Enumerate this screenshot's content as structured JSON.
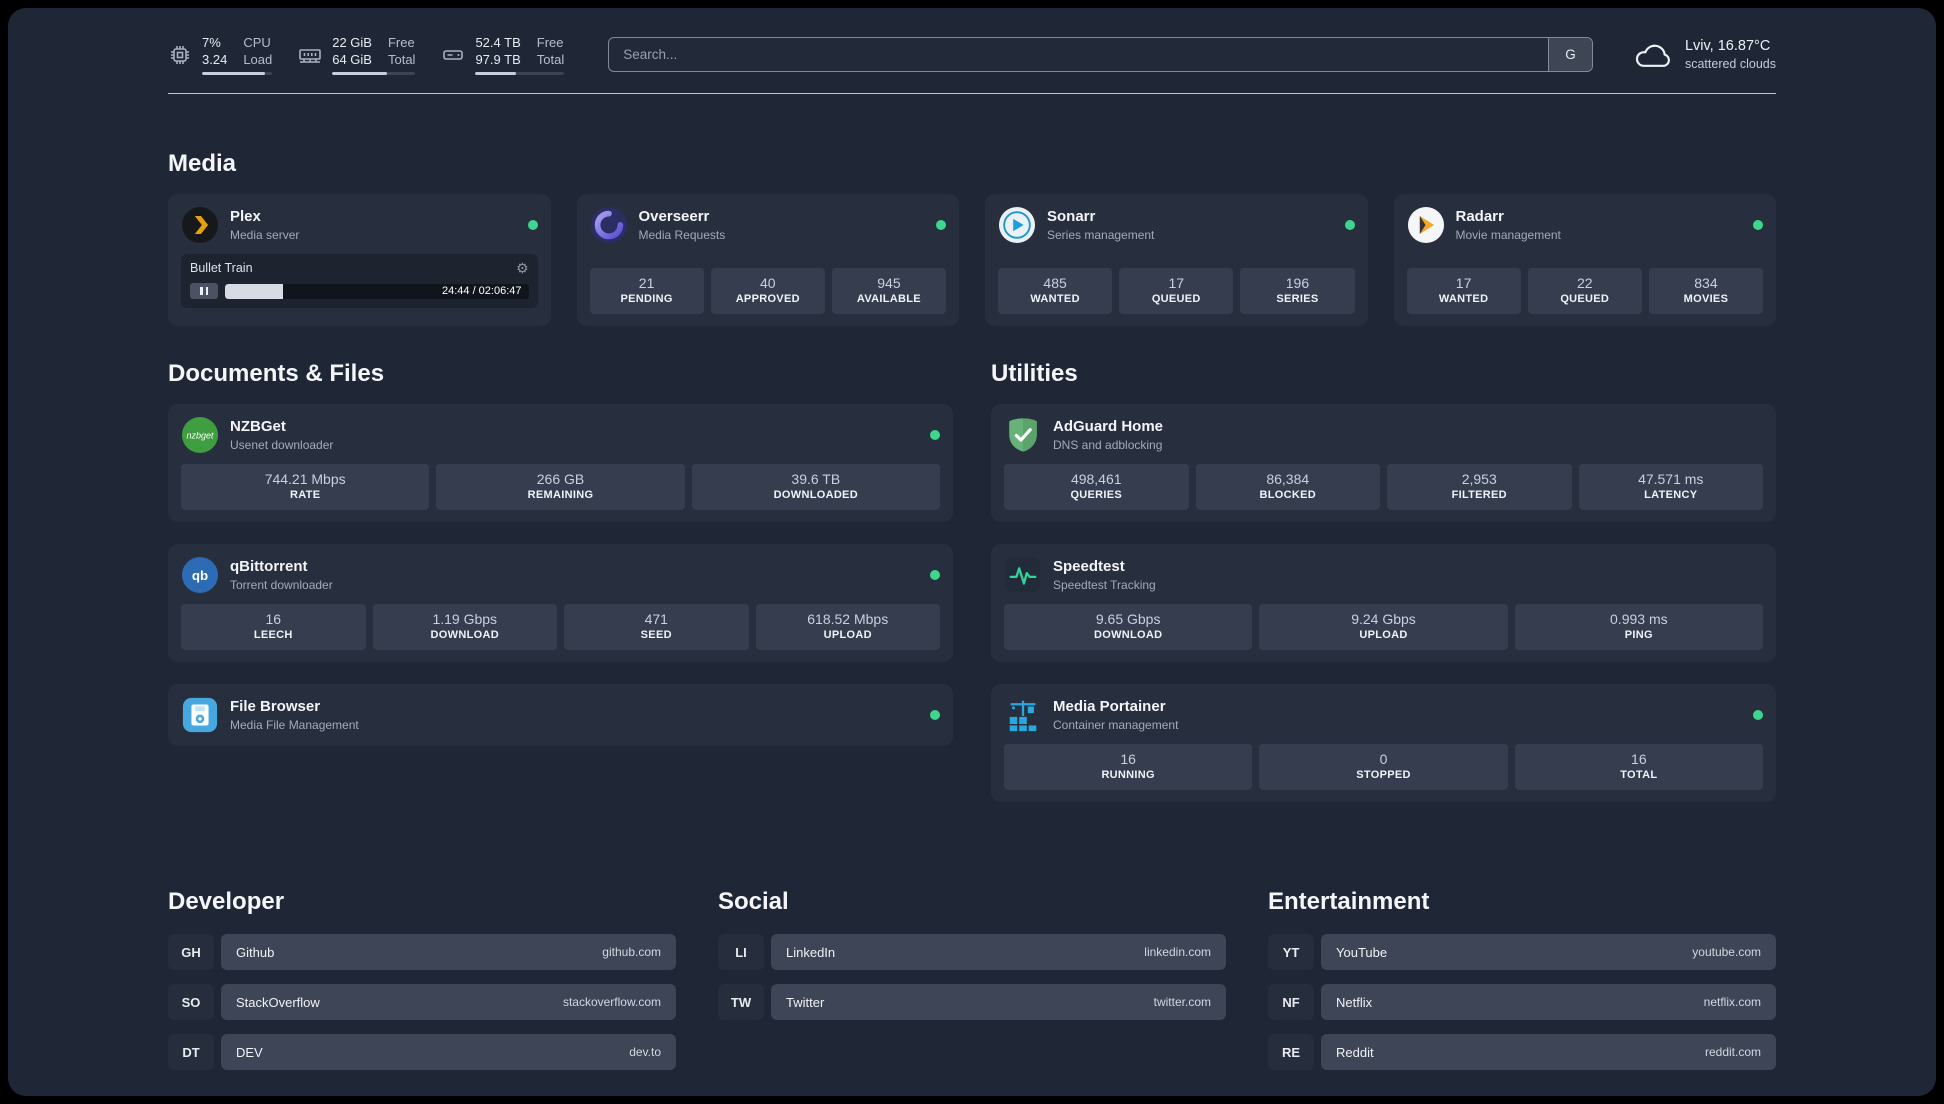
{
  "topbar": {
    "cpu": {
      "value_top": "7%",
      "value_bottom": "3.24",
      "label_top": "CPU",
      "label_bottom": "Load",
      "bar_pct": 90
    },
    "ram": {
      "value_top": "22 GiB",
      "value_bottom": "64 GiB",
      "label_top": "Free",
      "label_bottom": "Total",
      "bar_pct": 66
    },
    "disk": {
      "value_top": "52.4 TB",
      "value_bottom": "97.9 TB",
      "label_top": "Free",
      "label_bottom": "Total",
      "bar_pct": 46
    },
    "search": {
      "placeholder": "Search...",
      "button_label": "G"
    },
    "weather": {
      "location": "Lviv, 16.87°C",
      "condition": "scattered clouds"
    }
  },
  "media": {
    "title": "Media",
    "plex": {
      "name": "Plex",
      "subtitle": "Media server",
      "track": "Bullet Train",
      "time": "24:44 / 02:06:47",
      "progress_pct": 19,
      "gear_icon": "⚙"
    },
    "overseerr": {
      "name": "Overseerr",
      "subtitle": "Media Requests",
      "stats": [
        {
          "value": "21",
          "label": "PENDING"
        },
        {
          "value": "40",
          "label": "APPROVED"
        },
        {
          "value": "945",
          "label": "AVAILABLE"
        }
      ]
    },
    "sonarr": {
      "name": "Sonarr",
      "subtitle": "Series management",
      "stats": [
        {
          "value": "485",
          "label": "WANTED"
        },
        {
          "value": "17",
          "label": "QUEUED"
        },
        {
          "value": "196",
          "label": "SERIES"
        }
      ]
    },
    "radarr": {
      "name": "Radarr",
      "subtitle": "Movie management",
      "stats": [
        {
          "value": "17",
          "label": "WANTED"
        },
        {
          "value": "22",
          "label": "QUEUED"
        },
        {
          "value": "834",
          "label": "MOVIES"
        }
      ]
    }
  },
  "documents": {
    "title": "Documents & Files",
    "nzbget": {
      "name": "NZBGet",
      "subtitle": "Usenet downloader",
      "stats": [
        {
          "value": "744.21 Mbps",
          "label": "RATE"
        },
        {
          "value": "266 GB",
          "label": "REMAINING"
        },
        {
          "value": "39.6 TB",
          "label": "DOWNLOADED"
        }
      ]
    },
    "qbittorrent": {
      "name": "qBittorrent",
      "subtitle": "Torrent downloader",
      "stats": [
        {
          "value": "16",
          "label": "LEECH"
        },
        {
          "value": "1.19 Gbps",
          "label": "DOWNLOAD"
        },
        {
          "value": "471",
          "label": "SEED"
        },
        {
          "value": "618.52 Mbps",
          "label": "UPLOAD"
        }
      ]
    },
    "filebrowser": {
      "name": "File Browser",
      "subtitle": "Media File Management"
    }
  },
  "utilities": {
    "title": "Utilities",
    "adguard": {
      "name": "AdGuard Home",
      "subtitle": "DNS and adblocking",
      "stats": [
        {
          "value": "498,461",
          "label": "QUERIES"
        },
        {
          "value": "86,384",
          "label": "BLOCKED"
        },
        {
          "value": "2,953",
          "label": "FILTERED"
        },
        {
          "value": "47.571 ms",
          "label": "LATENCY"
        }
      ]
    },
    "speedtest": {
      "name": "Speedtest",
      "subtitle": "Speedtest Tracking",
      "stats": [
        {
          "value": "9.65 Gbps",
          "label": "DOWNLOAD"
        },
        {
          "value": "9.24 Gbps",
          "label": "UPLOAD"
        },
        {
          "value": "0.993 ms",
          "label": "PING"
        }
      ]
    },
    "portainer": {
      "name": "Media Portainer",
      "subtitle": "Container management",
      "stats": [
        {
          "value": "16",
          "label": "RUNNING"
        },
        {
          "value": "0",
          "label": "STOPPED"
        },
        {
          "value": "16",
          "label": "TOTAL"
        }
      ]
    }
  },
  "bookmarks": {
    "developer": {
      "title": "Developer",
      "items": [
        {
          "abbr": "GH",
          "name": "Github",
          "url": "github.com"
        },
        {
          "abbr": "SO",
          "name": "StackOverflow",
          "url": "stackoverflow.com"
        },
        {
          "abbr": "DT",
          "name": "DEV",
          "url": "dev.to"
        }
      ]
    },
    "social": {
      "title": "Social",
      "items": [
        {
          "abbr": "LI",
          "name": "LinkedIn",
          "url": "linkedin.com"
        },
        {
          "abbr": "TW",
          "name": "Twitter",
          "url": "twitter.com"
        }
      ]
    },
    "entertainment": {
      "title": "Entertainment",
      "items": [
        {
          "abbr": "YT",
          "name": "YouTube",
          "url": "youtube.com"
        },
        {
          "abbr": "NF",
          "name": "Netflix",
          "url": "netflix.com"
        },
        {
          "abbr": "RE",
          "name": "Reddit",
          "url": "reddit.com"
        }
      ]
    }
  },
  "colors": {
    "status_online": "#3dd68c",
    "accent_green": "#34d399"
  }
}
